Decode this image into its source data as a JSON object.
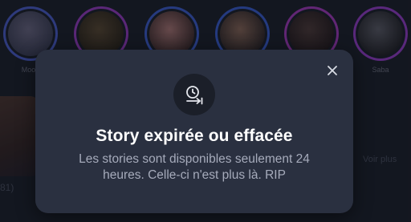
{
  "stories": [
    {
      "label": "Mood",
      "ring": "#4b5fd1",
      "img": [
        "#6d6a86",
        "#3a3e56"
      ]
    },
    {
      "label": "",
      "ring": "#9b3cc8",
      "img": [
        "#5b4a33",
        "#2a2419"
      ]
    },
    {
      "label": "",
      "ring": "#3d5fd6",
      "img": [
        "#b07a78",
        "#3c2a2a"
      ]
    },
    {
      "label": "",
      "ring": "#3a5fd8",
      "img": [
        "#8d6a5a",
        "#2c2526"
      ]
    },
    {
      "label": "",
      "ring": "#a83bc4",
      "img": [
        "#4f3c3a",
        "#231a1d"
      ]
    },
    {
      "label": "Saba",
      "ring": "#9a3ed0",
      "img": [
        "#5e5f6a",
        "#1f2025"
      ]
    }
  ],
  "background": {
    "left_text": "81)",
    "right_text": "Voir plus"
  },
  "modal": {
    "icon": "clock-skip-icon",
    "title": "Story expirée ou effacée",
    "body": "Les stories sont disponibles seulement 24 heures. Celle-ci n'est plus là. RIP",
    "close_icon": "close-icon"
  },
  "colors": {
    "modal_bg": "#2a3040",
    "page_bg": "#1b1f2a",
    "title": "#ffffff",
    "body_text": "#a6abbb"
  }
}
